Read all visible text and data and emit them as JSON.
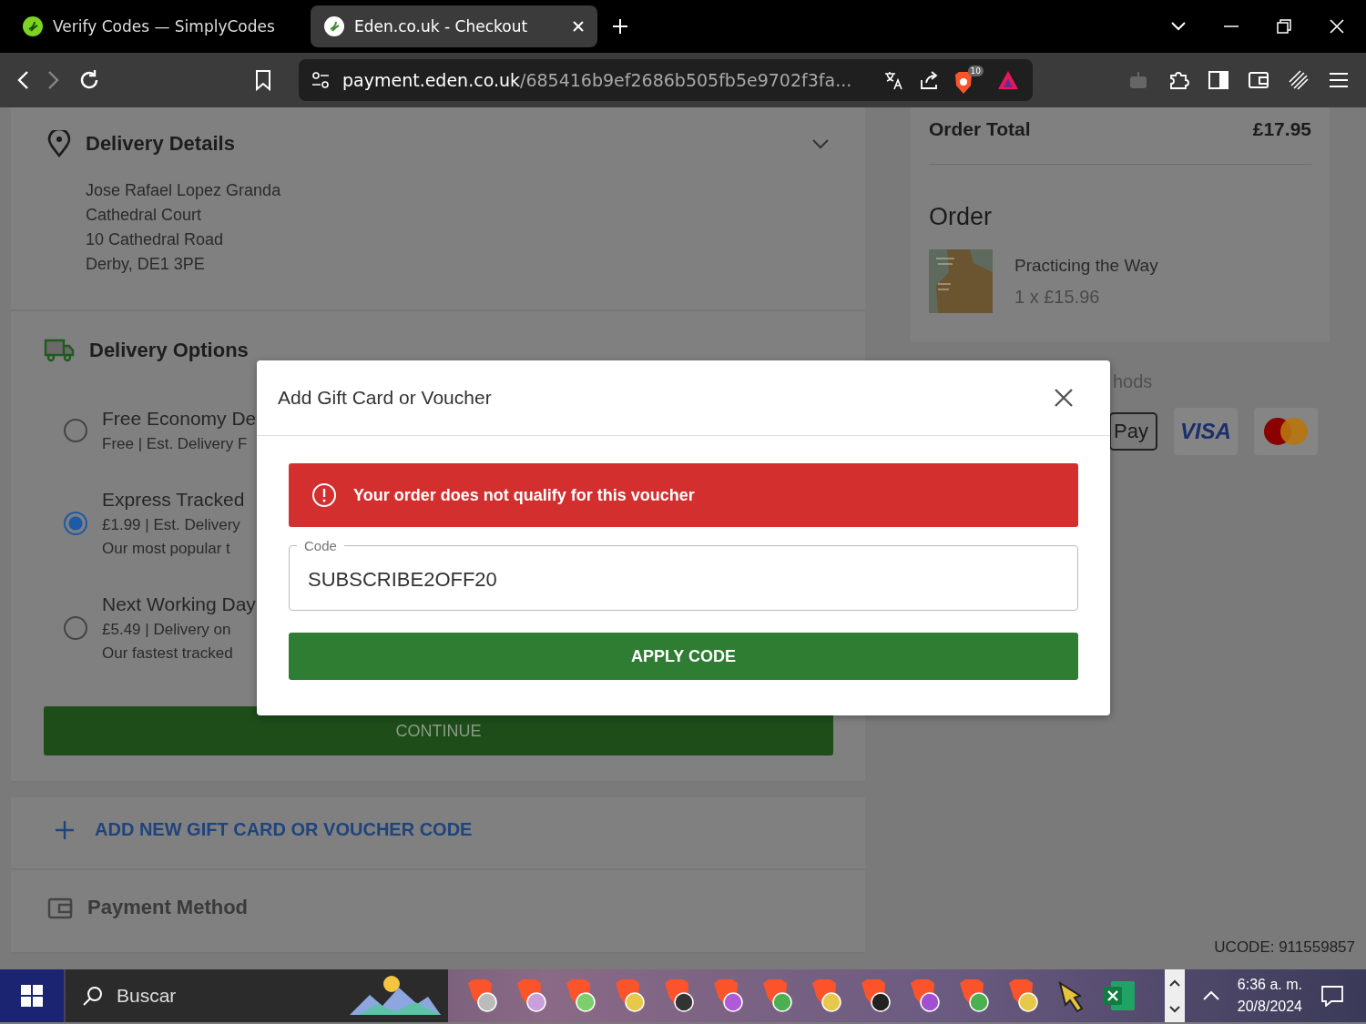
{
  "browser": {
    "tabs": [
      {
        "title": "Verify Codes — SimplyCodes",
        "selected": false
      },
      {
        "title": "Eden.co.uk - Checkout",
        "selected": true
      }
    ],
    "url_host": "payment.eden.co.uk",
    "url_path": "/685416b9ef2686b505fb5e9702f3fa...",
    "shields_count": "10"
  },
  "delivery_details": {
    "title": "Delivery Details",
    "address": [
      "Jose Rafael Lopez Granda",
      "Cathedral Court",
      "10 Cathedral Road",
      "Derby, DE1 3PE"
    ]
  },
  "delivery_options": {
    "title": "Delivery Options",
    "options": [
      {
        "name": "Free Economy De",
        "line": "Free | Est. Delivery F",
        "selected": false
      },
      {
        "name": "Express Tracked",
        "line": "£1.99 | Est. Delivery",
        "note": "Our most popular t",
        "selected": true
      },
      {
        "name": "Next Working Day",
        "line": "£5.49 | Delivery on",
        "note": "Our fastest tracked",
        "selected": false
      }
    ],
    "continue": "CONTINUE"
  },
  "gift_card": {
    "label": "ADD NEW GIFT CARD OR VOUCHER CODE"
  },
  "payment": {
    "title": "Payment Method"
  },
  "summary": {
    "total_label": "Order Total",
    "total": "£17.95",
    "order_title": "Order",
    "items": [
      {
        "title": "Practicing the Way",
        "qty_price": "1 x £15.96"
      }
    ],
    "methods_label": "hods",
    "pay_label": "Pay",
    "visa_label": "VISA"
  },
  "ucode": "UCODE: 911559857",
  "modal": {
    "title": "Add Gift Card or Voucher",
    "error": "Your order does not qualify for this voucher",
    "field": {
      "label": "Code",
      "value": "SUBSCRIBE2OFF20"
    },
    "apply": "APPLY CODE"
  },
  "taskbar": {
    "search": "Buscar",
    "time": "6:36 a. m.",
    "date": "20/8/2024"
  }
}
